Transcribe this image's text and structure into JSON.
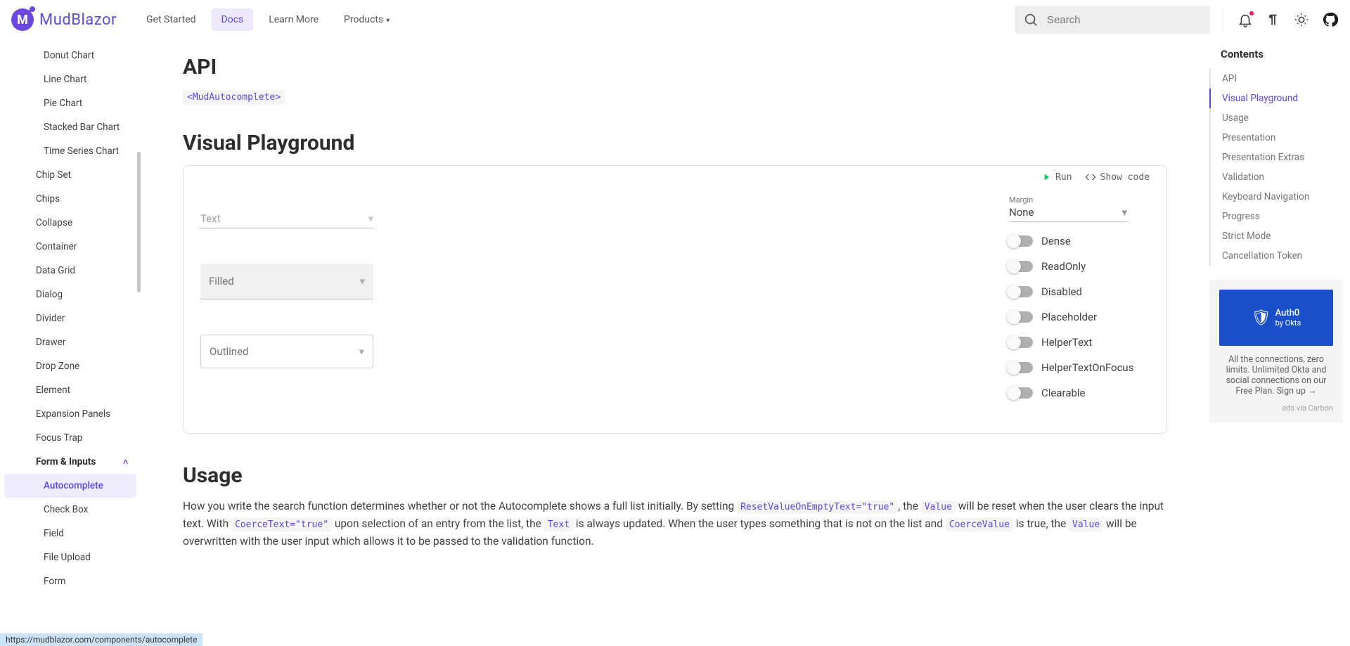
{
  "brand": "MudBlazor",
  "nav": {
    "getStarted": "Get Started",
    "docs": "Docs",
    "learn": "Learn More",
    "products": "Products"
  },
  "search": {
    "placeholder": "Search"
  },
  "sidebar": {
    "charts": {
      "donut": "Donut Chart",
      "line": "Line Chart",
      "pie": "Pie Chart",
      "stacked": "Stacked Bar Chart",
      "timeseries": "Time Series Chart"
    },
    "items": {
      "chipset": "Chip Set",
      "chips": "Chips",
      "collapse": "Collapse",
      "container": "Container",
      "datagrid": "Data Grid",
      "dialog": "Dialog",
      "divider": "Divider",
      "drawer": "Drawer",
      "dropzone": "Drop Zone",
      "element": "Element",
      "expansion": "Expansion Panels",
      "focustrap": "Focus Trap"
    },
    "formGroup": "Form & Inputs",
    "form": {
      "autocomplete": "Autocomplete",
      "checkbox": "Check Box",
      "field": "Field",
      "fileupload": "File Upload",
      "form": "Form"
    }
  },
  "main": {
    "api": {
      "title": "API",
      "link": "<MudAutocomplete>"
    },
    "playground": {
      "title": "Visual Playground",
      "run": "Run",
      "showcode": "Show code",
      "textLabel": "Text",
      "filledLabel": "Filled",
      "outlinedLabel": "Outlined",
      "marginLabel": "Margin",
      "marginValue": "None",
      "switches": {
        "dense": "Dense",
        "readonly": "ReadOnly",
        "disabled": "Disabled",
        "placeholder": "Placeholder",
        "helpertext": "HelperText",
        "helpertextfocus": "HelperTextOnFocus",
        "clearable": "Clearable"
      }
    },
    "usage": {
      "title": "Usage",
      "p1a": "How you write the search function determines whether or not the Autocomplete shows a full list initially. By setting ",
      "c1": "ResetValueOnEmptyText=\"true\"",
      "p1b": ", the ",
      "c2": "Value",
      "p1c": " will be reset when the user clears the input text. With ",
      "c3": "CoerceText=\"true\"",
      "p1d": " upon selection of an entry from the list, the ",
      "c4": "Text",
      "p1e": " is always updated. When the user types something that is not on the list and ",
      "c5": "CoerceValue",
      "p1f": " is true, the ",
      "c6": "Value",
      "p1g": " will be overwritten with the user input which allows it to be passed to the validation function."
    }
  },
  "toc": {
    "heading": "Contents",
    "items": {
      "api": "API",
      "visual": "Visual Playground",
      "usage": "Usage",
      "presentation": "Presentation",
      "presextras": "Presentation Extras",
      "validation": "Validation",
      "keyboard": "Keyboard Navigation",
      "progress": "Progress",
      "strict": "Strict Mode",
      "cancel": "Cancellation Token"
    }
  },
  "ad": {
    "bannerLine1": "Auth0",
    "bannerLine2": "by Okta",
    "copy": "All the connections, zero limits. Unlimited Okta and social connections on our Free Plan. Sign up →",
    "via": "ads via Carbon"
  },
  "status": "https://mudblazor.com/components/autocomplete"
}
